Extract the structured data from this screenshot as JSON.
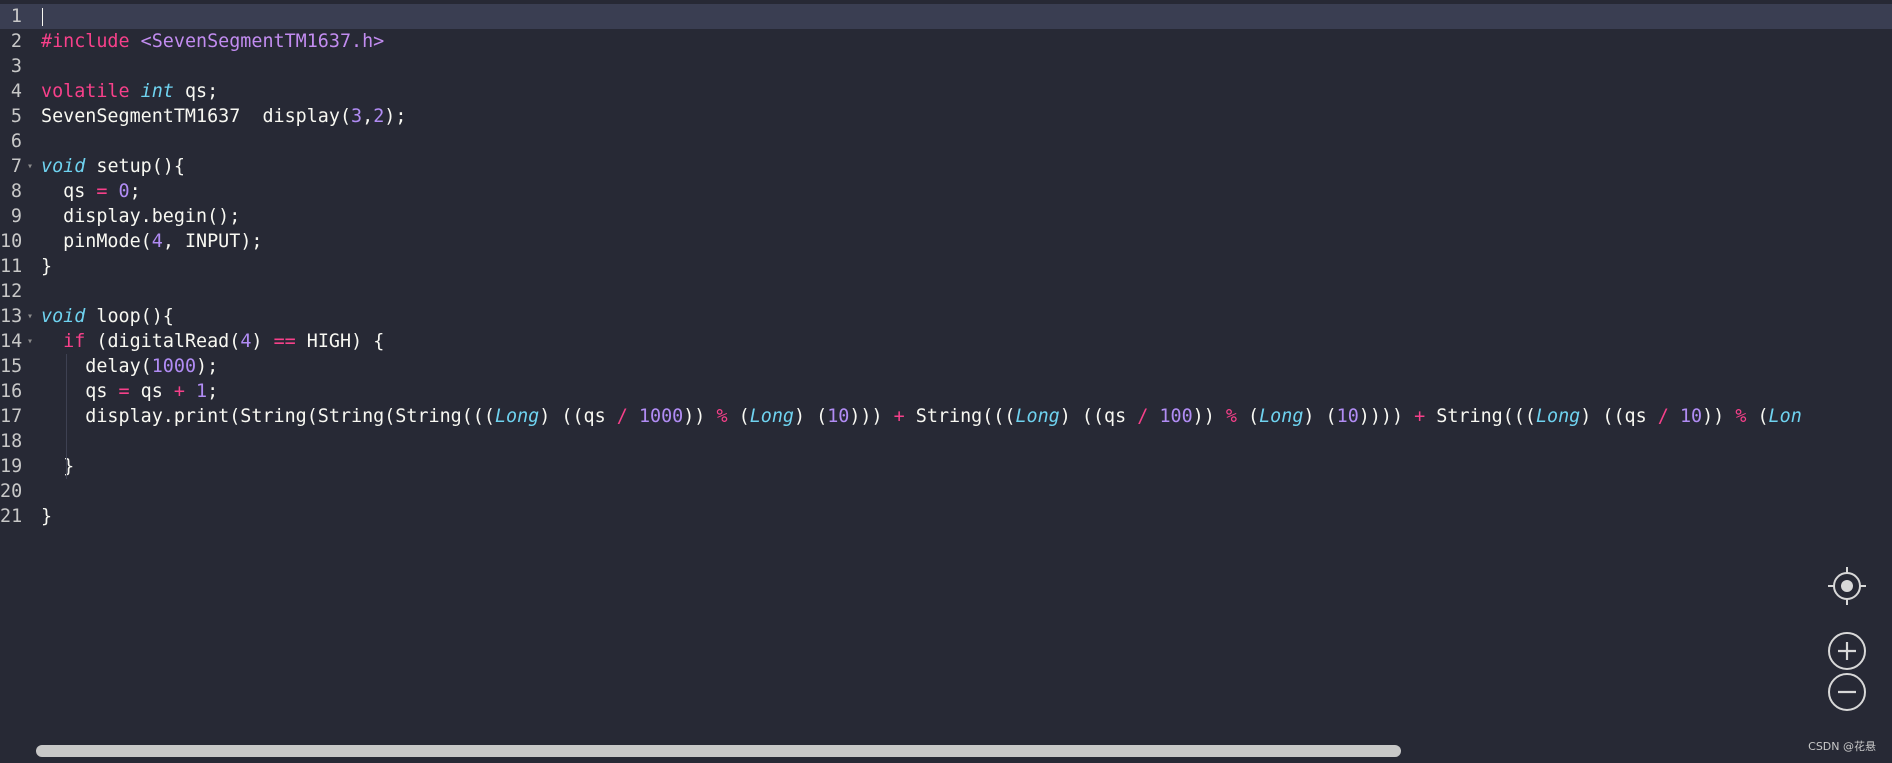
{
  "editor": {
    "active_line": 1,
    "lines": [
      {
        "n": "1",
        "fold": "",
        "tokens": []
      },
      {
        "n": "2",
        "fold": "",
        "tokens": [
          [
            "#include ",
            "kw"
          ],
          [
            "<SevenSegmentTM1637.h>",
            "str"
          ]
        ]
      },
      {
        "n": "3",
        "fold": "",
        "tokens": []
      },
      {
        "n": "4",
        "fold": "",
        "tokens": [
          [
            "volatile ",
            "kw"
          ],
          [
            "int",
            "type"
          ],
          [
            " qs;",
            "text"
          ]
        ]
      },
      {
        "n": "5",
        "fold": "",
        "tokens": [
          [
            "SevenSegmentTM1637  display(",
            "text"
          ],
          [
            "3",
            "num"
          ],
          [
            ",",
            "text"
          ],
          [
            "2",
            "num"
          ],
          [
            ");",
            "text"
          ]
        ]
      },
      {
        "n": "6",
        "fold": "",
        "tokens": []
      },
      {
        "n": "7",
        "fold": "▾",
        "tokens": [
          [
            "void",
            "type"
          ],
          [
            " setup(){",
            "text"
          ]
        ]
      },
      {
        "n": "8",
        "fold": "",
        "tokens": [
          [
            "  qs ",
            "text"
          ],
          [
            "=",
            "op"
          ],
          [
            " ",
            "text"
          ],
          [
            "0",
            "num"
          ],
          [
            ";",
            "text"
          ]
        ]
      },
      {
        "n": "9",
        "fold": "",
        "tokens": [
          [
            "  display.begin();",
            "text"
          ]
        ]
      },
      {
        "n": "10",
        "fold": "",
        "tokens": [
          [
            "  pinMode(",
            "text"
          ],
          [
            "4",
            "num"
          ],
          [
            ", INPUT);",
            "text"
          ]
        ]
      },
      {
        "n": "11",
        "fold": "",
        "tokens": [
          [
            "}",
            "text"
          ]
        ]
      },
      {
        "n": "12",
        "fold": "",
        "tokens": []
      },
      {
        "n": "13",
        "fold": "▾",
        "tokens": [
          [
            "void",
            "type"
          ],
          [
            " loop(){",
            "text"
          ]
        ]
      },
      {
        "n": "14",
        "fold": "▾",
        "tokens": [
          [
            "  ",
            "text"
          ],
          [
            "if",
            "kw"
          ],
          [
            " (digitalRead(",
            "text"
          ],
          [
            "4",
            "num"
          ],
          [
            ") ",
            "text"
          ],
          [
            "==",
            "op"
          ],
          [
            " HIGH) {",
            "text"
          ]
        ]
      },
      {
        "n": "15",
        "fold": "",
        "tokens": [
          [
            "    delay(",
            "text"
          ],
          [
            "1000",
            "num"
          ],
          [
            ");",
            "text"
          ]
        ]
      },
      {
        "n": "16",
        "fold": "",
        "tokens": [
          [
            "    qs ",
            "text"
          ],
          [
            "=",
            "op"
          ],
          [
            " qs ",
            "text"
          ],
          [
            "+",
            "op"
          ],
          [
            " ",
            "text"
          ],
          [
            "1",
            "num"
          ],
          [
            ";",
            "text"
          ]
        ]
      },
      {
        "n": "17",
        "fold": "",
        "tokens": [
          [
            "    display.print(String(String(String(((",
            "text"
          ],
          [
            "Long",
            "type"
          ],
          [
            ") ((qs ",
            "text"
          ],
          [
            "/",
            "op"
          ],
          [
            " ",
            "text"
          ],
          [
            "1000",
            "num"
          ],
          [
            ")) ",
            "text"
          ],
          [
            "%",
            "op"
          ],
          [
            " (",
            "text"
          ],
          [
            "Long",
            "type"
          ],
          [
            ") (",
            "text"
          ],
          [
            "10",
            "num"
          ],
          [
            "))) ",
            "text"
          ],
          [
            "+",
            "op"
          ],
          [
            " String(((",
            "text"
          ],
          [
            "Long",
            "type"
          ],
          [
            ") ((qs ",
            "text"
          ],
          [
            "/",
            "op"
          ],
          [
            " ",
            "text"
          ],
          [
            "100",
            "num"
          ],
          [
            ")) ",
            "text"
          ],
          [
            "%",
            "op"
          ],
          [
            " (",
            "text"
          ],
          [
            "Long",
            "type"
          ],
          [
            ") (",
            "text"
          ],
          [
            "10",
            "num"
          ],
          [
            ")))) ",
            "text"
          ],
          [
            "+",
            "op"
          ],
          [
            " String(((",
            "text"
          ],
          [
            "Long",
            "type"
          ],
          [
            ") ((qs ",
            "text"
          ],
          [
            "/",
            "op"
          ],
          [
            " ",
            "text"
          ],
          [
            "10",
            "num"
          ],
          [
            ")) ",
            "text"
          ],
          [
            "%",
            "op"
          ],
          [
            " (",
            "text"
          ],
          [
            "Lon",
            "type"
          ]
        ]
      },
      {
        "n": "18",
        "fold": "",
        "tokens": []
      },
      {
        "n": "19",
        "fold": "",
        "tokens": [
          [
            "  }",
            "text"
          ]
        ]
      },
      {
        "n": "20",
        "fold": "",
        "tokens": []
      },
      {
        "n": "21",
        "fold": "",
        "tokens": [
          [
            "}",
            "text"
          ]
        ]
      }
    ]
  },
  "toolbar": {
    "locate_icon": "crosshair-icon",
    "zoom_in_icon": "plus-icon",
    "zoom_out_icon": "minus-icon"
  },
  "footer": {
    "credit": "CSDN @花悬"
  }
}
